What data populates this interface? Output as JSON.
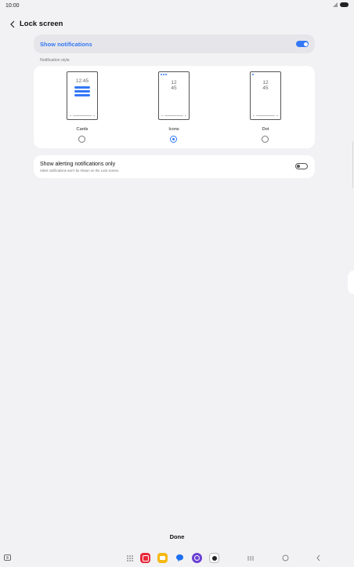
{
  "status_bar": {
    "time": "10:00"
  },
  "header": {
    "title": "Lock screen"
  },
  "show_notifications": {
    "label": "Show notifications",
    "enabled": true
  },
  "notification_style": {
    "section_label": "Notification style",
    "options": [
      {
        "label": "Cards",
        "selected": false,
        "clock": "12:45"
      },
      {
        "label": "Icons",
        "selected": true,
        "clock_hour": "12",
        "clock_min": "45"
      },
      {
        "label": "Dot",
        "selected": false,
        "clock_hour": "12",
        "clock_min": "45"
      }
    ]
  },
  "alerting_only": {
    "title": "Show alerting notifications only",
    "subtitle": "Silent notifications won't be shown on the Lock screen.",
    "enabled": false
  },
  "footer": {
    "done_label": "Done"
  },
  "colors": {
    "accent": "#3478f6",
    "background": "#f2f2f4",
    "card": "#ffffff"
  },
  "nav_bar": {
    "icons": [
      "apps-grid-icon",
      "app-red-icon",
      "app-yellow-icon",
      "app-chat-icon",
      "app-purple-icon",
      "app-camera-icon",
      "recents-icon",
      "home-icon",
      "back-icon"
    ]
  }
}
